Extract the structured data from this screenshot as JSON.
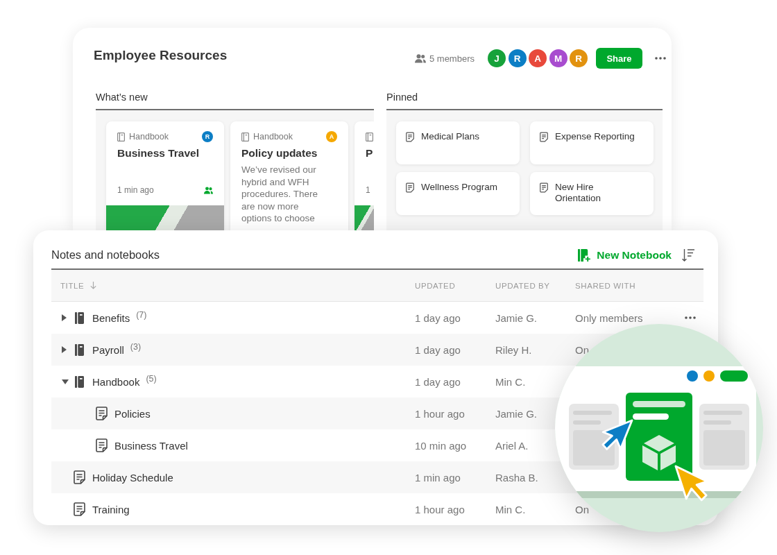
{
  "workspace": {
    "title": "Employee Resources",
    "members": "5 members",
    "avatars": [
      {
        "initial": "J",
        "color": "#16a23a"
      },
      {
        "initial": "R",
        "color": "#0c7ec5"
      },
      {
        "initial": "A",
        "color": "#e8493b"
      },
      {
        "initial": "M",
        "color": "#a84ccf"
      },
      {
        "initial": "R",
        "color": "#e2920f"
      }
    ],
    "share_button": "Share"
  },
  "whats_new": {
    "title": "What’s new",
    "cards": [
      {
        "notebook": "Handbook",
        "title": "Business Travel",
        "time": "1 min ago",
        "avatar": {
          "initial": "R",
          "color": "#0c7ec5"
        },
        "shared": true,
        "photo": true
      },
      {
        "notebook": "Handbook",
        "title": "Policy updates",
        "body": "We’ve revised our hybrid and WFH procedures. There are now more options to choose",
        "avatar": {
          "initial": "A",
          "color": "#f5a800"
        }
      },
      {
        "title": "P",
        "time": "1",
        "photo": true
      }
    ]
  },
  "pinned": {
    "title": "Pinned",
    "items": [
      {
        "title": "Medical Plans"
      },
      {
        "title": "Expense Reporting"
      },
      {
        "title": "Wellness Program"
      },
      {
        "title": "New Hire Orientation"
      }
    ]
  },
  "notes": {
    "title": "Notes and notebooks",
    "new_button": "New Notebook",
    "columns": [
      {
        "label": "TITLE",
        "sorted": true
      },
      {
        "label": "UPDATED",
        "sorted": false
      },
      {
        "label": "UPDATED BY",
        "sorted": false
      },
      {
        "label": "SHARED WITH",
        "sorted": false
      }
    ],
    "rows": [
      {
        "kind": "notebook",
        "title": "Benefits",
        "count": "(7)",
        "expanded": false,
        "updated": "1 day ago",
        "updated_by": "Jamie G.",
        "shared_with": "Only members",
        "hovered": true
      },
      {
        "kind": "notebook",
        "title": "Payroll",
        "count": "(3)",
        "expanded": false,
        "updated": "1 day ago",
        "updated_by": "Riley H.",
        "shared_with": "On"
      },
      {
        "kind": "notebook",
        "title": "Handbook",
        "count": "(5)",
        "expanded": true,
        "updated": "1 day ago",
        "updated_by": "Min C.",
        "children": [
          {
            "kind": "note",
            "title": "Policies",
            "updated": "1 hour ago",
            "updated_by": "Jamie G."
          },
          {
            "kind": "note",
            "title": "Business Travel",
            "updated": "10 min ago",
            "updated_by": "Ariel A."
          }
        ]
      },
      {
        "kind": "note",
        "title": "Holiday Schedule",
        "updated": "1 min ago",
        "updated_by": "Rasha B."
      },
      {
        "kind": "note",
        "title": "Training",
        "updated": "1 hour ago",
        "updated_by": "Min C.",
        "shared_with": "On"
      }
    ]
  }
}
